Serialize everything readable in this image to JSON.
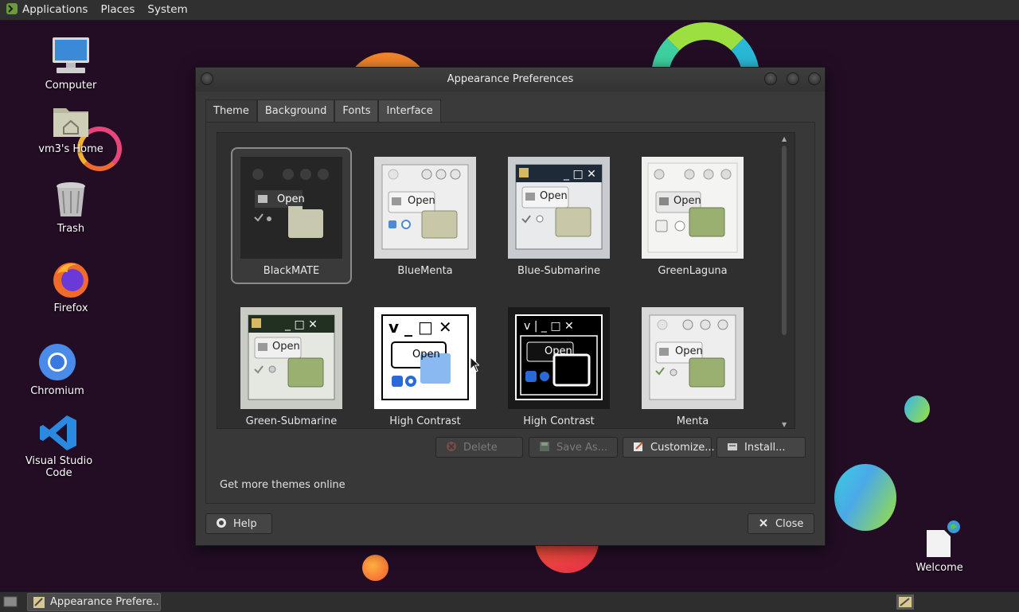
{
  "top_panel": {
    "menus": [
      "Applications",
      "Places",
      "System"
    ]
  },
  "desktop": {
    "icons": [
      {
        "label": "Computer"
      },
      {
        "label": "vm3's Home"
      },
      {
        "label": "Trash"
      },
      {
        "label": "Firefox"
      },
      {
        "label": "Chromium"
      },
      {
        "label": "Visual Studio Code"
      },
      {
        "label": "Welcome"
      }
    ]
  },
  "window": {
    "title": "Appearance Preferences",
    "tabs": [
      {
        "label": "Theme",
        "active": true
      },
      {
        "label": "Background",
        "active": false
      },
      {
        "label": "Fonts",
        "active": false
      },
      {
        "label": "Interface",
        "active": false
      }
    ],
    "themes": [
      {
        "name": "BlackMATE",
        "selected": true
      },
      {
        "name": "BlueMenta",
        "selected": false
      },
      {
        "name": "Blue-Submarine",
        "selected": false
      },
      {
        "name": "GreenLaguna",
        "selected": false
      },
      {
        "name": "Green-Submarine",
        "selected": false
      },
      {
        "name": "High Contrast",
        "selected": false
      },
      {
        "name": "High Contrast",
        "selected": false
      },
      {
        "name": "Menta",
        "selected": false
      }
    ],
    "preview_open_label": "Open",
    "buttons": {
      "delete": "Delete",
      "save_as": "Save As...",
      "customize": "Customize...",
      "install": "Install...",
      "help": "Help",
      "close": "Close"
    },
    "more_themes_link": "Get more themes online"
  },
  "bottom_panel": {
    "task_label": "Appearance Prefere..."
  },
  "colors": {
    "desktop_bg": "#230d25",
    "panel_bg": "#303030",
    "window_bg": "#3a3a3a"
  }
}
